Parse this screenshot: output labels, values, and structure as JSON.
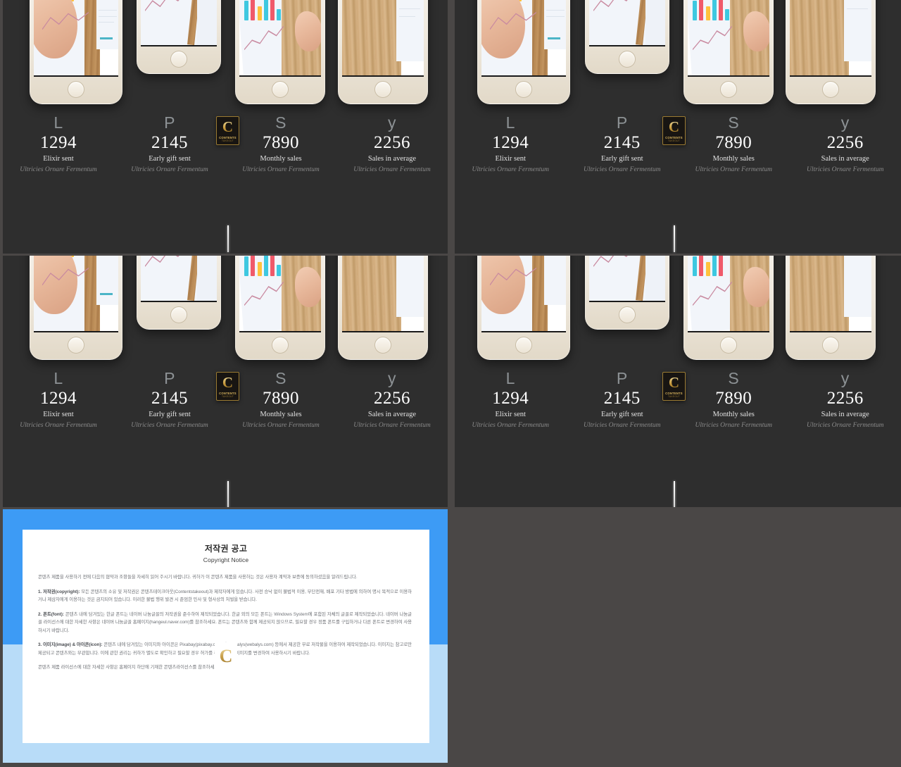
{
  "theme": {
    "page_background": "#4a4746",
    "panel_background": "#2e2e2e",
    "accent_blue": "#3d9bf5",
    "accent_blue_light": "#b8dcf8",
    "gold": "#c79a3d",
    "stat_number_color": "#ffffff",
    "stat_glyph_color": "#8d9295",
    "stat_sub_color": "#8b8b8b"
  },
  "logo": {
    "letter": "C",
    "line1": "CONTENTS",
    "line2": "TAKEOUT"
  },
  "slide": {
    "stats": [
      {
        "glyph": "L",
        "number": "1294",
        "label": "Elixir sent",
        "sub": "Ultricies Ornare Fermentum"
      },
      {
        "glyph": "P",
        "number": "2145",
        "label": "Early gift sent",
        "sub": "Ultricies Ornare Fermentum"
      },
      {
        "glyph": "S",
        "number": "7890",
        "label": "Monthly sales",
        "sub": "Ultricies Ornare Fermentum"
      },
      {
        "glyph": "y",
        "number": "2256",
        "label": "Sales in average",
        "sub": "Ultricies Ornare Fermentum"
      }
    ]
  },
  "copyright": {
    "title": "저작권 공고",
    "subtitle": "Copyright Notice",
    "intro": "콘텐츠 제품을 사용하기 전에 다음의 협약과 조항들을 자세히 읽어 주시기 바랍니다. 귀하가 이 콘텐츠 제품을 사용하는 것은 사용자 계약과 보증에 동의하셨음을 알려드립니다.",
    "item1_label": "1. 저작권(copyright):",
    "item1": "모든 콘텐츠의 소유 및 저작권은 콘텐츠테이크아웃(Contentstakeout)과 제작자에게 있습니다. 사전 승낙 없이 불법적 이용, 무단전재, 배포 기타 방법에 의하여 명시 목적으로 이용하거나 제삼자에게 이용하는 것은 금지되어 있습니다. 이러한 불법 행위 발견 시 준엄한 민사 및 형사상의 처벌을 받습니다.",
    "item2_label": "2. 폰트(font):",
    "item2": "콘텐츠 내에 담겨있는 한글 폰트는 네이버 나눔글꼴의 저작권을 준수하여 제작되었습니다. 한글 외의 모든 폰트는 Windows System에 포함된 자체의 글꼴로 제작되었습니다. 네이버 나눔글꼴 라이선스에 대한 자세한 사항은 네이버 나눔글꼴 홈페이지(hangeul.naver.com)를 참조하세요. 폰트는 콘텐츠와 함께 제공되지 않으므로, 필요할 경우 정품 폰트를 구입하거나 다른 폰트로 변경하여 사용하시기 바랍니다.",
    "item3_label": "3. 이미지(image) & 아이콘(icon):",
    "item3": "콘텐츠 내에 담겨있는 이미지와 아이콘은 Pixabay(pixabay.com)와 Webalys(webalys.com) 등에서 제공한 무료 저작물을 이용하여 제작되었습니다. 이미지는 참고로만 제공되고 콘텐츠와는 무관합니다. 이에 관한 권리는 귀하가 별도로 확인하고 필요할 경우 허가를 취득하거나 이미지를 변경하여 사용하시기 바랍니다.",
    "footer": "콘텐츠 제품 라이선스에 대한 자세한 사항은 홈페이지 하단에 기재한 콘텐츠라이선스를 참조하세요."
  }
}
